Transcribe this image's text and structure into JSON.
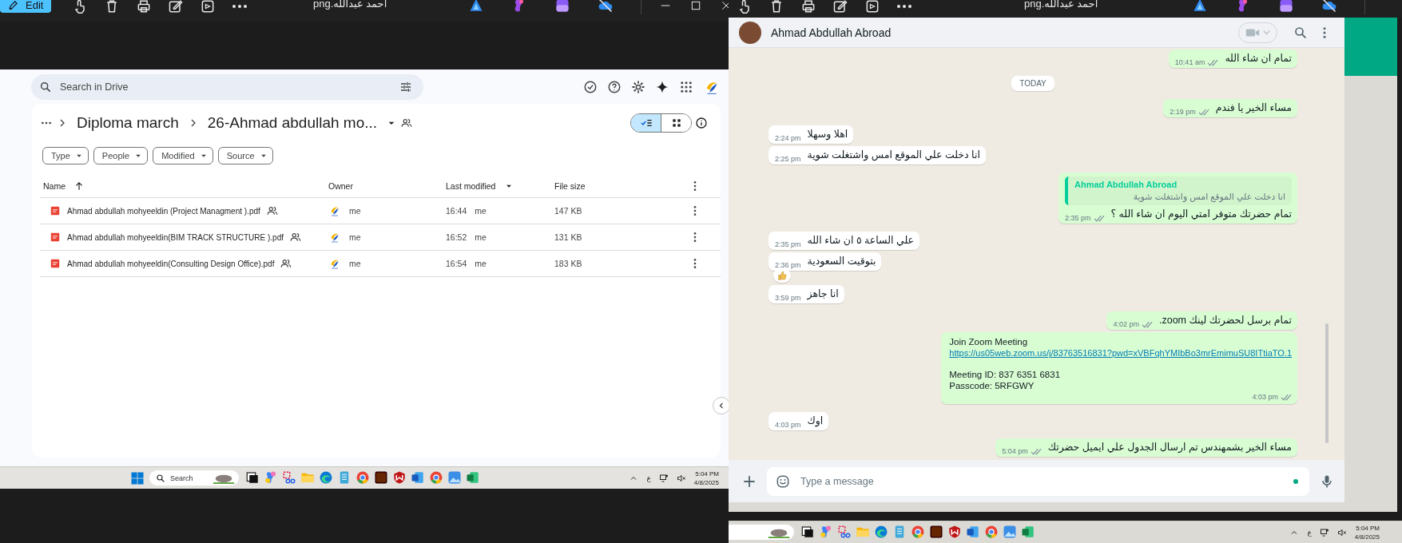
{
  "left_viewer": {
    "edit_button": "Edit",
    "title": "احمد عبدالله.png"
  },
  "drive": {
    "search": {
      "placeholder": "Search in Drive"
    },
    "breadcrumb": [
      "Diploma march",
      "26-Ahmad abdullah mo..."
    ],
    "view_toggle": [
      {
        "kind": "list",
        "selected": true
      },
      {
        "kind": "grid",
        "selected": false
      }
    ],
    "filters": [
      "Type",
      "People",
      "Modified",
      "Source"
    ],
    "columns": [
      "Name",
      "Owner",
      "Last modified",
      "File size"
    ],
    "files": [
      {
        "name": "Ahmad abdullah mohyeeldin (Project Managment ).pdf",
        "owner": "me",
        "modified": "16:44",
        "modified_by": "me",
        "size": "147 KB"
      },
      {
        "name": "Ahmad abdullah mohyeeldin(BIM TRACK STRUCTURE ).pdf",
        "owner": "me",
        "modified": "16:52",
        "modified_by": "me",
        "size": "131 KB"
      },
      {
        "name": "Ahmad abdullah mohyeeldin(Consulting Design Office).pdf",
        "owner": "me",
        "modified": "16:54",
        "modified_by": "me",
        "size": "183 KB"
      }
    ]
  },
  "left_taskbar": {
    "search": {
      "placeholder": "Search"
    },
    "language": "ع",
    "time": "5:04 PM",
    "date": "4/8/2025"
  },
  "right_viewer": {
    "title": "احمد عبدالله.png"
  },
  "chat": {
    "contact": "Ahmad Abdullah Abroad",
    "messages": [
      {
        "kind": "out",
        "text": "تمام ان شاء الله",
        "time": "10:41 am"
      },
      {
        "kind": "date",
        "text": "TODAY"
      },
      {
        "kind": "out",
        "text": "مساء الخير يا فندم",
        "time": "2:19 pm"
      },
      {
        "kind": "in",
        "text": "اهلا وسهلا",
        "time": "2:24 pm"
      },
      {
        "kind": "in",
        "text": "انا دخلت علي الموقع امس واشتغلت شوية",
        "time": "2:25 pm"
      },
      {
        "kind": "out",
        "quote": {
          "author": "Ahmad Abdullah Abroad",
          "text": "انا دخلت علي الموقع امس واشتغلت شوية"
        },
        "text": "تمام حضرتك متوفر امتي اليوم ان شاء الله ؟",
        "time": "2:35 pm"
      },
      {
        "kind": "in",
        "text": "علي الساعة ٥ ان شاء الله",
        "time": "2:35 pm"
      },
      {
        "kind": "in",
        "text": "بتوقيت السعودية",
        "time": "2:36 pm",
        "reaction": true
      },
      {
        "kind": "in",
        "text": "انا جاهز",
        "time": "3:59 pm"
      },
      {
        "kind": "out",
        "text": "تمام برسل لحضرتك لينك zoom.",
        "time": "4:02 pm"
      },
      {
        "kind": "out",
        "text": "Join Zoom Meeting",
        "link": "https://us05web.zoom.us/j/83763516831?pwd=xVBFqhYMIbBo3mrEmimuSU8ITtiaTO.1",
        "details": [
          "Meeting ID: 837 6351 6831",
          "Passcode: 5RFGWY"
        ],
        "time": "4:03 pm"
      },
      {
        "kind": "in",
        "text": "اوك",
        "time": "4:03 pm"
      },
      {
        "kind": "out",
        "text": "مساء الخير بشمهندس تم ارسال الجدول علي ايميل حضرتك",
        "time": "5:04 pm"
      }
    ],
    "composer": {
      "placeholder": "Type a message"
    }
  },
  "right_taskbar": {
    "language": "ع",
    "time": "5:04 PM",
    "date": "4/8/2025"
  }
}
